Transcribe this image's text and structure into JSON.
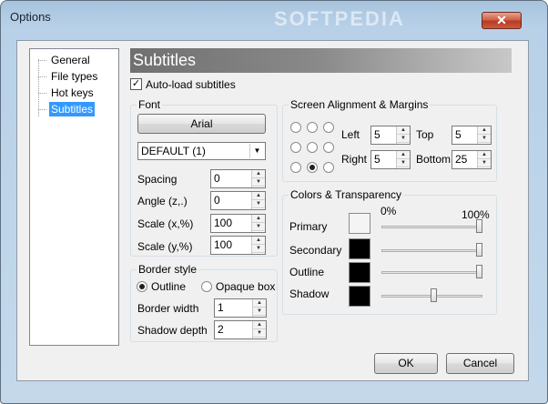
{
  "window": {
    "title": "Options",
    "watermark": "SOFTPEDIA",
    "close_glyph": "✕"
  },
  "tree": {
    "items": [
      {
        "label": "General",
        "selected": false
      },
      {
        "label": "File types",
        "selected": false
      },
      {
        "label": "Hot keys",
        "selected": false
      },
      {
        "label": "Subtitles",
        "selected": true
      }
    ]
  },
  "header": {
    "title": "Subtitles"
  },
  "autoload": {
    "label": "Auto-load subtitles",
    "checked": true,
    "mark": "✓"
  },
  "font": {
    "group_title": "Font",
    "font_button": "Arial",
    "charset_value": "DEFAULT (1)",
    "spacing_label": "Spacing",
    "spacing_value": "0",
    "angle_label": "Angle (z,.)",
    "angle_value": "0",
    "scalex_label": "Scale (x,%)",
    "scalex_value": "100",
    "scaley_label": "Scale (y,%)",
    "scaley_value": "100"
  },
  "border": {
    "group_title": "Border style",
    "outline_label": "Outline",
    "outline_selected": true,
    "opaque_label": "Opaque box",
    "opaque_selected": false,
    "width_label": "Border width",
    "width_value": "1",
    "shadow_label": "Shadow depth",
    "shadow_value": "2"
  },
  "alignment": {
    "group_title": "Screen Alignment & Margins",
    "selected_position": "bottom-center",
    "left_label": "Left",
    "left_value": "5",
    "top_label": "Top",
    "top_value": "5",
    "right_label": "Right",
    "right_value": "5",
    "bottom_label": "Bottom",
    "bottom_value": "25"
  },
  "colors": {
    "group_title": "Colors & Transparency",
    "min_label": "0%",
    "max_label": "100%",
    "rows": [
      {
        "label": "Primary",
        "color": "#f4f4f4",
        "transparency": 1.0
      },
      {
        "label": "Secondary",
        "color": "#000000",
        "transparency": 1.0
      },
      {
        "label": "Outline",
        "color": "#000000",
        "transparency": 1.0
      },
      {
        "label": "Shadow",
        "color": "#000000",
        "transparency": 0.52
      }
    ]
  },
  "buttons": {
    "ok": "OK",
    "cancel": "Cancel"
  }
}
